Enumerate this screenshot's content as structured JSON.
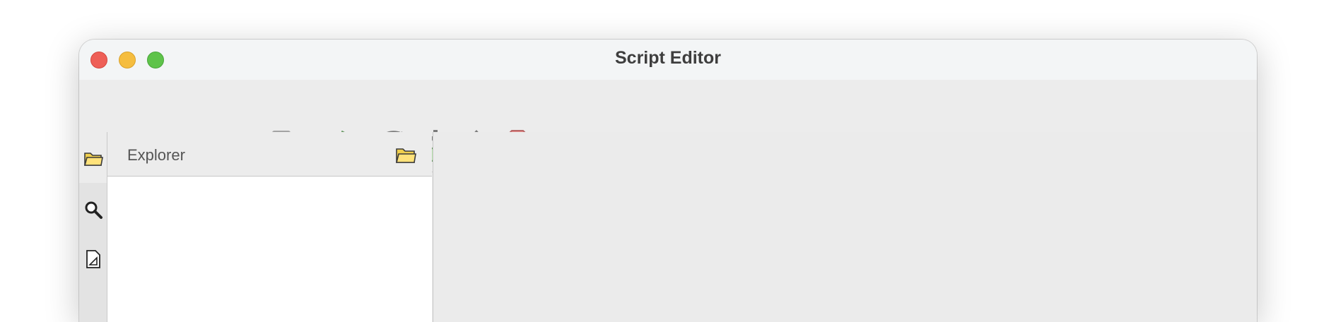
{
  "window": {
    "title": "Script Editor"
  },
  "toolbar": {
    "buttons": [
      {
        "name": "new-file",
        "icon": "new-document-icon"
      },
      {
        "name": "open-file",
        "icon": "open-folder-icon"
      },
      {
        "name": "save",
        "icon": "save-disk-icon"
      },
      {
        "name": "save-as",
        "icon": "save-as-disk-icon"
      },
      {
        "name": "save-all",
        "icon": "save-all-disks-icon"
      },
      {
        "name": "run",
        "icon": "play-icon"
      },
      {
        "name": "step-over",
        "icon": "step-over-icon"
      },
      {
        "name": "step-into",
        "icon": "step-into-icon"
      },
      {
        "name": "step-out",
        "icon": "step-out-icon"
      },
      {
        "name": "stop",
        "icon": "stop-hand-icon"
      },
      {
        "name": "toggle-sidebar",
        "icon": "collapse-left-panel-icon"
      },
      {
        "name": "toggle-console",
        "icon": "collapse-bottom-panel-icon"
      }
    ]
  },
  "sidebar": {
    "tabs": [
      {
        "name": "explorer",
        "icon": "folder-icon",
        "active": true
      },
      {
        "name": "search",
        "icon": "magnifier-icon",
        "active": false
      },
      {
        "name": "outline",
        "icon": "document-ruler-icon",
        "active": false
      }
    ]
  },
  "explorer": {
    "title": "Explorer",
    "items": []
  },
  "colors": {
    "window_bg": "#ececec",
    "titlebar_bg": "#f3f5f6",
    "close": "#ee5f57",
    "minimize": "#f5bd3f",
    "maximize": "#5ec34a",
    "run_green": "#8fd18a",
    "stop_red": "#e58a89"
  }
}
